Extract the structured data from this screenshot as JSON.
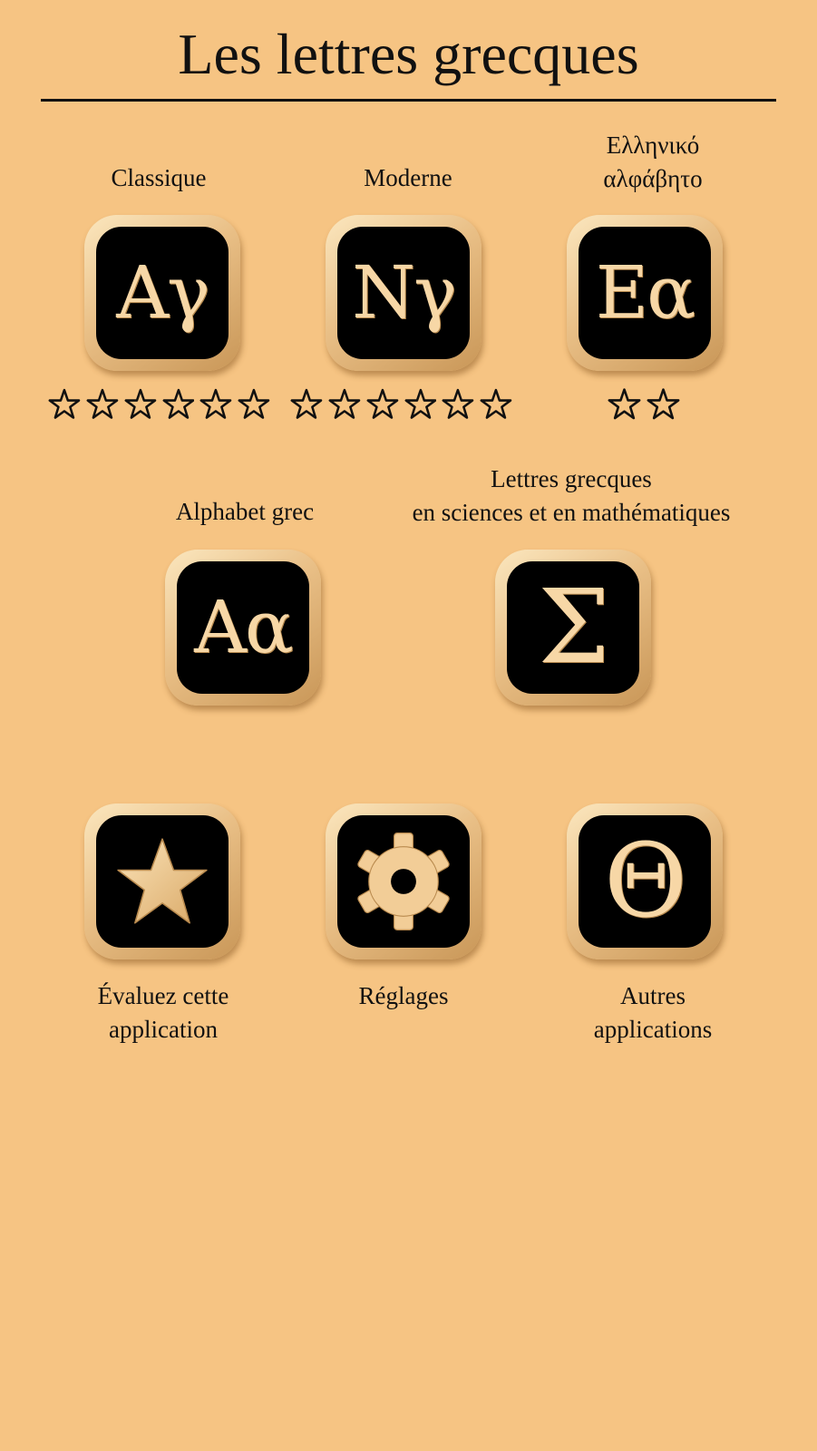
{
  "header": {
    "title": "Les lettres grecques"
  },
  "menu": [
    {
      "label": "Classique",
      "glyph": "Αγ",
      "stars": 6
    },
    {
      "label": "Moderne",
      "glyph": "Νγ",
      "stars": 6
    },
    {
      "label": "Ελληνικό\nαλφάβητο",
      "glyph": "Εα",
      "stars": 2
    },
    {
      "label": "Alphabet grec",
      "glyph": "Αα"
    },
    {
      "label": "Lettres grecques\nen sciences et en mathématiques",
      "glyph": "Σ"
    }
  ],
  "actions": {
    "rate": {
      "label": "Évaluez cette\napplication",
      "icon": "star-icon"
    },
    "settings": {
      "label": "Réglages",
      "icon": "gear-icon"
    },
    "more_apps": {
      "label": "Autres\napplications",
      "icon": "theta-icon",
      "glyph": "Θ"
    }
  },
  "colors": {
    "background": "#f6c483",
    "tile_gold": "#e9bf86",
    "tile_face": "#000000",
    "glyph": "#f7d7a6"
  }
}
